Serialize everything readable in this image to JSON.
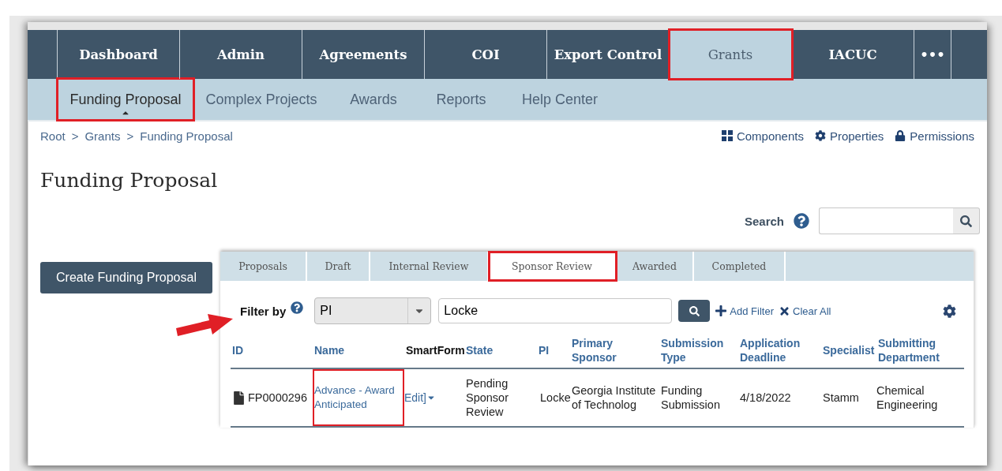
{
  "nav": {
    "items": [
      {
        "label": "Dashboard",
        "selected": false,
        "highlighted": false
      },
      {
        "label": "Admin",
        "selected": false,
        "highlighted": false
      },
      {
        "label": "Agreements",
        "selected": false,
        "highlighted": false
      },
      {
        "label": "COI",
        "selected": false,
        "highlighted": false
      },
      {
        "label": "Export Control",
        "selected": false,
        "highlighted": false
      },
      {
        "label": "Grants",
        "selected": true,
        "highlighted": true
      },
      {
        "label": "IACUC",
        "selected": false,
        "highlighted": false
      },
      {
        "label": "•••",
        "selected": false,
        "highlighted": false
      }
    ]
  },
  "subnav": {
    "items": [
      {
        "label": "Funding Proposal",
        "selected": true,
        "highlighted": true
      },
      {
        "label": "Complex Projects",
        "selected": false,
        "highlighted": false
      },
      {
        "label": "Awards",
        "selected": false,
        "highlighted": false
      },
      {
        "label": "Reports",
        "selected": false,
        "highlighted": false
      },
      {
        "label": "Help Center",
        "selected": false,
        "highlighted": false
      }
    ]
  },
  "breadcrumb": {
    "separator": ">",
    "items": [
      "Root",
      "Grants",
      "Funding Proposal"
    ]
  },
  "actions": [
    {
      "label": "Components",
      "kind": "grid"
    },
    {
      "label": "Properties",
      "kind": "gear"
    },
    {
      "label": "Permissions",
      "kind": "lock"
    }
  ],
  "title": "Funding Proposal",
  "create_button": "Create Funding Proposal",
  "search": {
    "label": "Search"
  },
  "tabs": [
    {
      "label": "Proposals",
      "selected": false,
      "highlighted": false
    },
    {
      "label": "Draft",
      "selected": false,
      "highlighted": false
    },
    {
      "label": "Internal Review",
      "selected": false,
      "highlighted": false
    },
    {
      "label": "Sponsor Review",
      "selected": true,
      "highlighted": true
    },
    {
      "label": "Awarded",
      "selected": false,
      "highlighted": false
    },
    {
      "label": "Completed",
      "selected": false,
      "highlighted": false
    }
  ],
  "filter": {
    "label": "Filter by",
    "field": "PI",
    "value": "Locke",
    "add_filter": "Add Filter",
    "clear_all": "Clear All",
    "pointer_arrow": true
  },
  "table": {
    "columns": [
      {
        "label": "ID",
        "kind": "link"
      },
      {
        "label": "Name",
        "kind": "link"
      },
      {
        "label": "SmartForm",
        "kind": "plain"
      },
      {
        "label": "State",
        "kind": "link"
      },
      {
        "label": "PI",
        "kind": "link"
      },
      {
        "label": "Primary Sponsor",
        "kind": "link"
      },
      {
        "label": "Submission Type",
        "kind": "link"
      },
      {
        "label": "Application Deadline",
        "kind": "link"
      },
      {
        "label": "Specialist",
        "kind": "link"
      },
      {
        "label": "Submitting Department",
        "kind": "link"
      }
    ],
    "rows": [
      {
        "id": "FP0000296",
        "name": "Advance - Award Anticipated",
        "name_highlighted": true,
        "smartform": "Edit]",
        "state": "Pending Sponsor Review",
        "pi": "Locke",
        "sponsor": "Georgia Institute of Technolog",
        "submission_type": "Funding Submission",
        "deadline": "4/18/2022",
        "specialist": "Stamm",
        "department": "Chemical Engineering"
      }
    ]
  }
}
